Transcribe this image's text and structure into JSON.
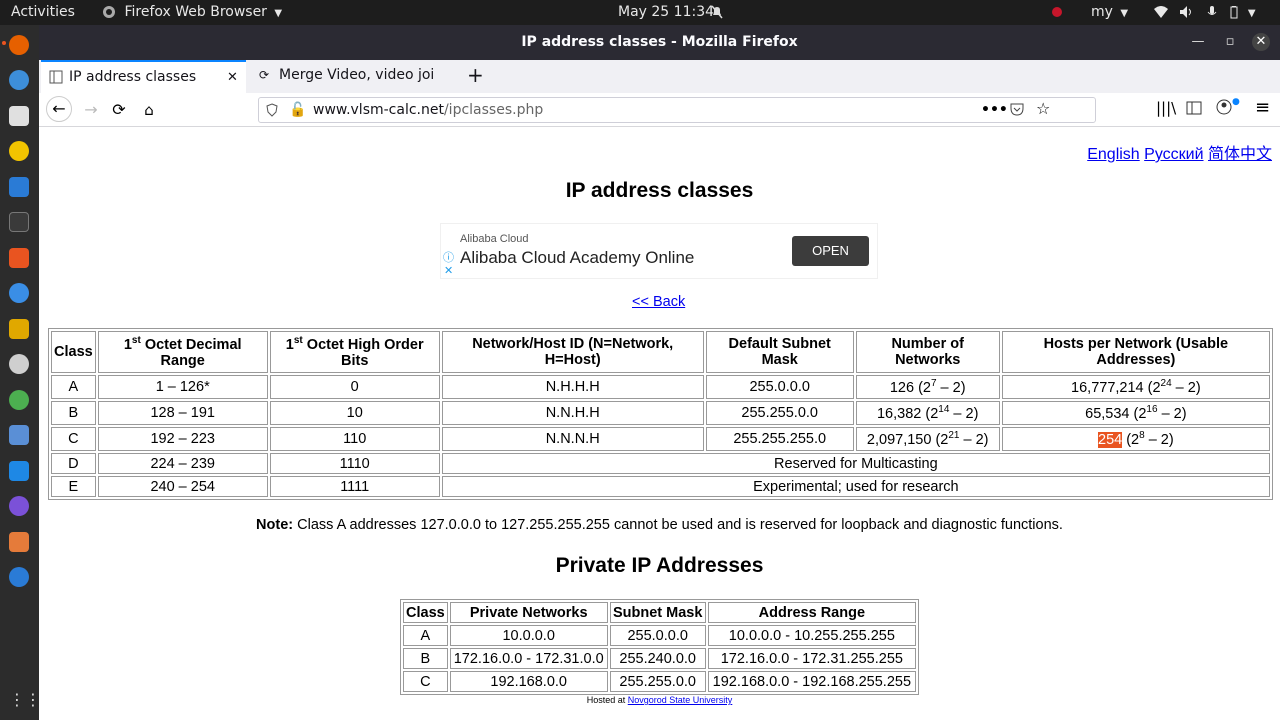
{
  "topbar": {
    "activities": "Activities",
    "app_name": "Firefox Web Browser",
    "clock": "May 25  11:34",
    "input_source": "my"
  },
  "window": {
    "title": "IP address classes - Mozilla Firefox"
  },
  "tabs": [
    {
      "label": "IP address classes"
    },
    {
      "label": "Merge Video, video joi"
    }
  ],
  "urlbar": {
    "url_host": "www.vlsm-calc.net",
    "url_path": "/ipclasses.php"
  },
  "page": {
    "languages": [
      "English",
      "Русский",
      "简体中文"
    ],
    "title": "IP address classes",
    "ad": {
      "brand": "Alibaba Cloud",
      "headline": "Alibaba Cloud Academy Online",
      "button": "OPEN"
    },
    "back_link": "<< Back",
    "classes_table": {
      "headers": {
        "class": "Class",
        "first_octet_pre": "1",
        "first_octet_sup": "st",
        "range_label": " Octet Decimal Range",
        "bits_label": " Octet High Order Bits",
        "network_host": "Network/Host ID (N=Network, H=Host)",
        "mask": "Default Subnet Mask",
        "networks": "Number of Networks",
        "hosts": "Hosts per Network (Usable Addresses)"
      },
      "rows": [
        {
          "class": "A",
          "range": "1 – 126*",
          "bits": "0",
          "nh": "N.H.H.H",
          "mask": "255.0.0.0",
          "networks": "126",
          "networks_exp": "7",
          "hosts": "16,777,214",
          "hosts_exp": "24"
        },
        {
          "class": "B",
          "range": "128 – 191",
          "bits": "10",
          "nh": "N.N.H.H",
          "mask": "255.255.0.0",
          "networks": "16,382",
          "networks_exp": "14",
          "hosts": "65,534",
          "hosts_exp": "16"
        },
        {
          "class": "C",
          "range": "192 – 223",
          "bits": "110",
          "nh": "N.N.N.H",
          "mask": "255.255.255.0",
          "networks": "2,097,150",
          "networks_exp": "21",
          "hosts": "254",
          "hosts_exp": "8"
        },
        {
          "class": "D",
          "range": "224 – 239",
          "bits": "1110",
          "span": "Reserved for Multicasting"
        },
        {
          "class": "E",
          "range": "240 – 254",
          "bits": "1111",
          "span": "Experimental; used for research"
        }
      ]
    },
    "note_label": "Note:",
    "note_text": " Class A addresses 127.0.0.0 to 127.255.255.255 cannot be used and is reserved for loopback and diagnostic functions.",
    "private_title": "Private IP Addresses",
    "private_table": {
      "headers": [
        "Class",
        "Private Networks",
        "Subnet Mask",
        "Address Range"
      ],
      "rows": [
        [
          "A",
          "10.0.0.0",
          "255.0.0.0",
          "10.0.0.0 - 10.255.255.255"
        ],
        [
          "B",
          "172.16.0.0 - 172.31.0.0",
          "255.240.0.0",
          "172.16.0.0 - 172.31.255.255"
        ],
        [
          "C",
          "192.168.0.0",
          "255.255.0.0",
          "192.168.0.0 - 192.168.255.255"
        ]
      ]
    },
    "footer_text": "Hosted at ",
    "footer_link": "Novgorod State University"
  },
  "colors": {
    "topbar_bg": "#1d1d1d",
    "dock_bg": "#2c2c2c",
    "accent": "#e95420",
    "tab_accent": "#0a84ff",
    "link": "#0000ee"
  }
}
